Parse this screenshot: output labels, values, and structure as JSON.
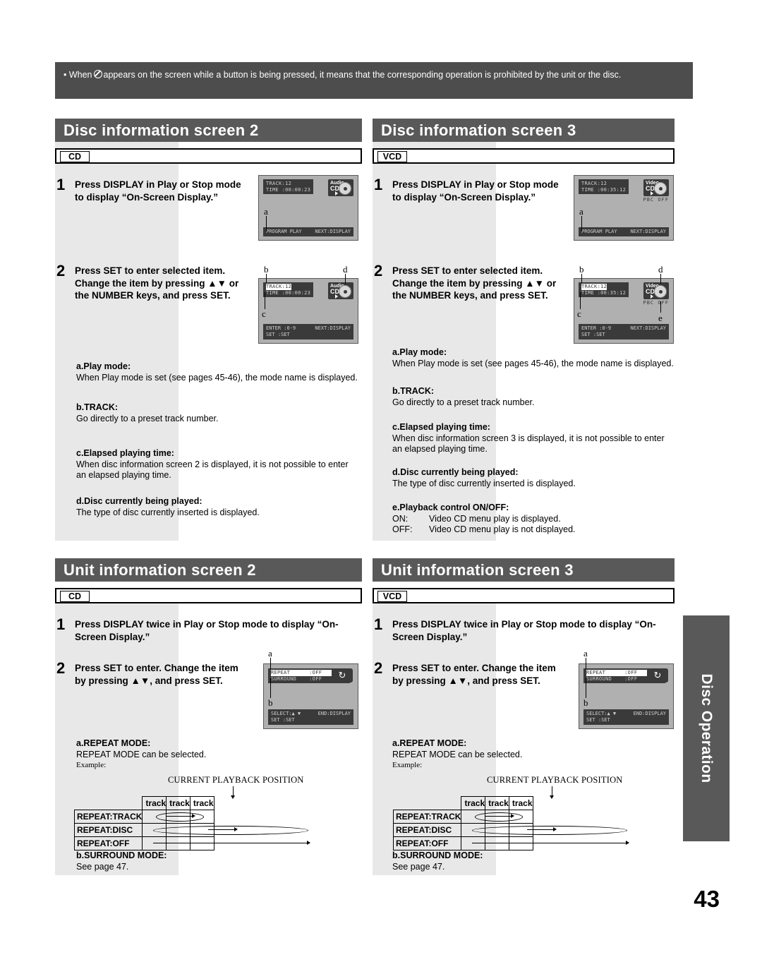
{
  "note": {
    "text_before": "• When",
    "icon": "prohibited-icon",
    "text_after": "appears on the screen while a button is being pressed, it means that the corresponding operation is prohibited by the unit or the disc."
  },
  "side_tab": {
    "label": "Disc Operation"
  },
  "page_number": "43",
  "colors": {
    "header_bg": "#595959",
    "band_bg": "#e8e8e8",
    "screen_bg": "#b0b0b0",
    "osd_bg": "#3a3a3a"
  },
  "sections": {
    "disc_info_2": {
      "title": "Disc information screen 2",
      "disc_tag": "CD",
      "steps": [
        {
          "num": "1",
          "text": "Press DISPLAY in Play or Stop mode to display “On-Screen Display.”"
        },
        {
          "num": "2",
          "text": "Press SET to enter selected item. Change the item by pressing ▲▼ or the NUMBER keys, and press SET."
        }
      ],
      "screen1": {
        "track_line": "TRACK:12",
        "time_line": "TIME :00:00:23",
        "badge_top": "Audio",
        "badge_bottom": "CD",
        "status_left": "PROGRAM PLAY",
        "status_right": "NEXT:DISPLAY",
        "callouts": [
          "a"
        ]
      },
      "screen2": {
        "track_line": "TRACK:12",
        "time_line": "TIME :00:00:23",
        "badge_top": "Audio",
        "badge_bottom": "CD",
        "hint_line1_left": "ENTER :0-9",
        "hint_line2_left": "SET  :SET",
        "hint_right": "NEXT:DISPLAY",
        "callouts": [
          "b",
          "c",
          "d"
        ]
      },
      "items": [
        {
          "title": "a.Play mode:",
          "text": "When Play mode is set (see pages 45-46), the mode name is displayed."
        },
        {
          "title": "b.TRACK:",
          "text": "Go directly to a preset track number."
        },
        {
          "title": "c.Elapsed playing time:",
          "text": "When disc information screen 2 is displayed, it is not possible to enter an elapsed playing time."
        },
        {
          "title": "d.Disc currently being played:",
          "text": "The type of disc currently inserted is displayed."
        }
      ]
    },
    "disc_info_3": {
      "title": "Disc information screen 3",
      "disc_tag": "VCD",
      "steps": [
        {
          "num": "1",
          "text": "Press DISPLAY in Play or Stop mode to display “On-Screen Display.”"
        },
        {
          "num": "2",
          "text": "Press SET to enter selected item. Change the item by pressing ▲▼ or the NUMBER keys, and press SET."
        }
      ],
      "screen1": {
        "track_line": "TRACK:12",
        "time_line": "TIME :00:35:12",
        "badge_top": "Video",
        "badge_bottom": "CD",
        "pbc": "PBC  OFF",
        "status_left": "PROGRAM PLAY",
        "status_right": "NEXT:DISPLAY",
        "callouts": [
          "a"
        ]
      },
      "screen2": {
        "track_line": "TRACK:12",
        "time_line": "TIME :00:35:12",
        "badge_top": "Video",
        "badge_bottom": "CD",
        "pbc": "PBC  OFF",
        "hint_line1_left": "ENTER :0-9",
        "hint_line2_left": "SET  :SET",
        "hint_right": "NEXT:DISPLAY",
        "callouts": [
          "b",
          "c",
          "d",
          "e"
        ]
      },
      "items": [
        {
          "title": "a.Play mode:",
          "text": "When Play mode is set (see pages 45-46), the mode name is displayed."
        },
        {
          "title": "b.TRACK:",
          "text": "Go directly to a preset track number."
        },
        {
          "title": "c.Elapsed playing time:",
          "text": "When disc information screen 3 is displayed, it is not possible to enter an elapsed playing time."
        },
        {
          "title": "d.Disc currently being played:",
          "text": "The type of disc currently inserted is displayed."
        },
        {
          "title": "e.Playback control ON/OFF:",
          "on_label": "ON:",
          "on_text": "Video CD menu play is displayed.",
          "off_label": "OFF:",
          "off_text": "Video CD menu play is not displayed."
        }
      ]
    },
    "unit_info_2": {
      "title": "Unit information screen 2",
      "disc_tag": "CD",
      "steps": [
        {
          "num": "1",
          "text": "Press DISPLAY twice in Play or Stop mode  to display “On-Screen Display.”"
        },
        {
          "num": "2",
          "text": "Press SET to enter. Change the item by pressing ▲▼, and press SET."
        }
      ],
      "screen": {
        "row1": "REPEAT      :OFF",
        "row2": "SURROUND    :OFF",
        "hint_line1": "SELECT:▲ ▼",
        "hint_line2": "SET   :SET",
        "hint_right": "END:DISPLAY",
        "icon": "repeat-icon",
        "callouts": [
          "a",
          "b"
        ]
      },
      "items": [
        {
          "title": "a.REPEAT MODE:",
          "text": "REPEAT MODE can be selected.",
          "example_label": "Example:"
        },
        {
          "title": "b.SURROUND MODE:",
          "text": "See page 47."
        }
      ]
    },
    "unit_info_3": {
      "title": "Unit information screen 3",
      "disc_tag": "VCD",
      "steps": [
        {
          "num": "1",
          "text": "Press DISPLAY twice in Play or Stop mode  to display “On-Screen Display.”"
        },
        {
          "num": "2",
          "text": "Press SET to enter. Change the item by pressing ▲▼, and press SET."
        }
      ],
      "screen": {
        "row1": "REPEAT      :OFF",
        "row2": "SURROUND    :OFF",
        "hint_line1": "SELECT:▲ ▼",
        "hint_line2": "SET   :SET",
        "hint_right": "END:DISPLAY",
        "icon": "repeat-icon",
        "callouts": [
          "a",
          "b"
        ]
      },
      "items": [
        {
          "title": "a.REPEAT MODE:",
          "text": "REPEAT MODE can be selected.",
          "example_label": "Example:"
        },
        {
          "title": "b.SURROUND MODE:",
          "text": "See page 47."
        }
      ]
    }
  },
  "repeat_table": {
    "caption": "CURRENT PLAYBACK POSITION",
    "columns": [
      "track",
      "track",
      "track"
    ],
    "rows": [
      {
        "label": "REPEAT:TRACK",
        "span": "middle-loop"
      },
      {
        "label": "REPEAT:DISC",
        "span": "full-loop"
      },
      {
        "label": "REPEAT:OFF",
        "span": "straight-arrow"
      }
    ]
  }
}
